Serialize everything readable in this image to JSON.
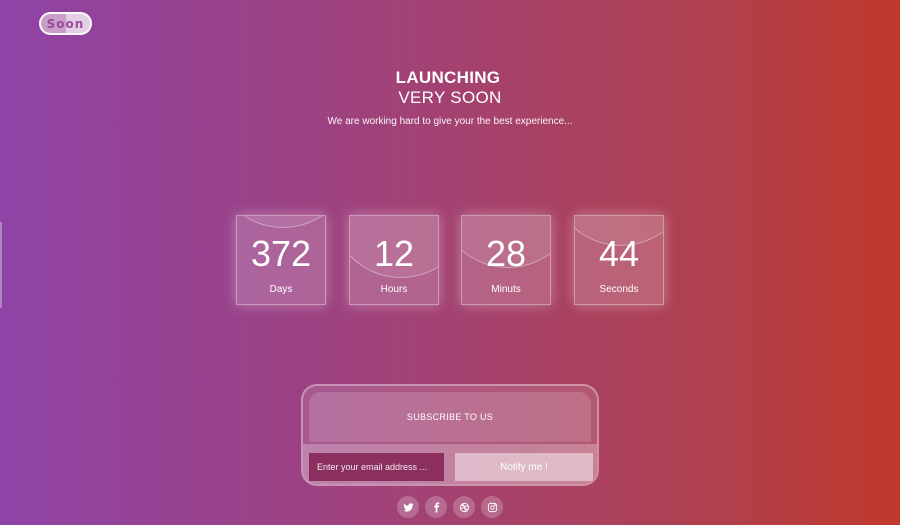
{
  "logo": {
    "text": "Soon"
  },
  "hero": {
    "title_line1": "LAUNCHING",
    "title_line2": "VERY SOON",
    "tagline": "We are working hard to give your the best experience..."
  },
  "countdown": [
    {
      "value": "372",
      "label": "Days"
    },
    {
      "value": "12",
      "label": "Hours"
    },
    {
      "value": "28",
      "label": "Minuts"
    },
    {
      "value": "44",
      "label": "Seconds"
    }
  ],
  "subscribe": {
    "heading": "SUBSCRIBE TO US",
    "email_placeholder": "Enter your email address ...",
    "notify_label": "Notify me !"
  },
  "social": [
    {
      "icon": "twitter-icon"
    },
    {
      "icon": "facebook-icon"
    },
    {
      "icon": "dribbble-icon"
    },
    {
      "icon": "instagram-icon"
    }
  ],
  "colors": {
    "gradient_start": "#8e43a6",
    "gradient_end": "#c0392b",
    "input_bg": "#8a2f5e"
  }
}
